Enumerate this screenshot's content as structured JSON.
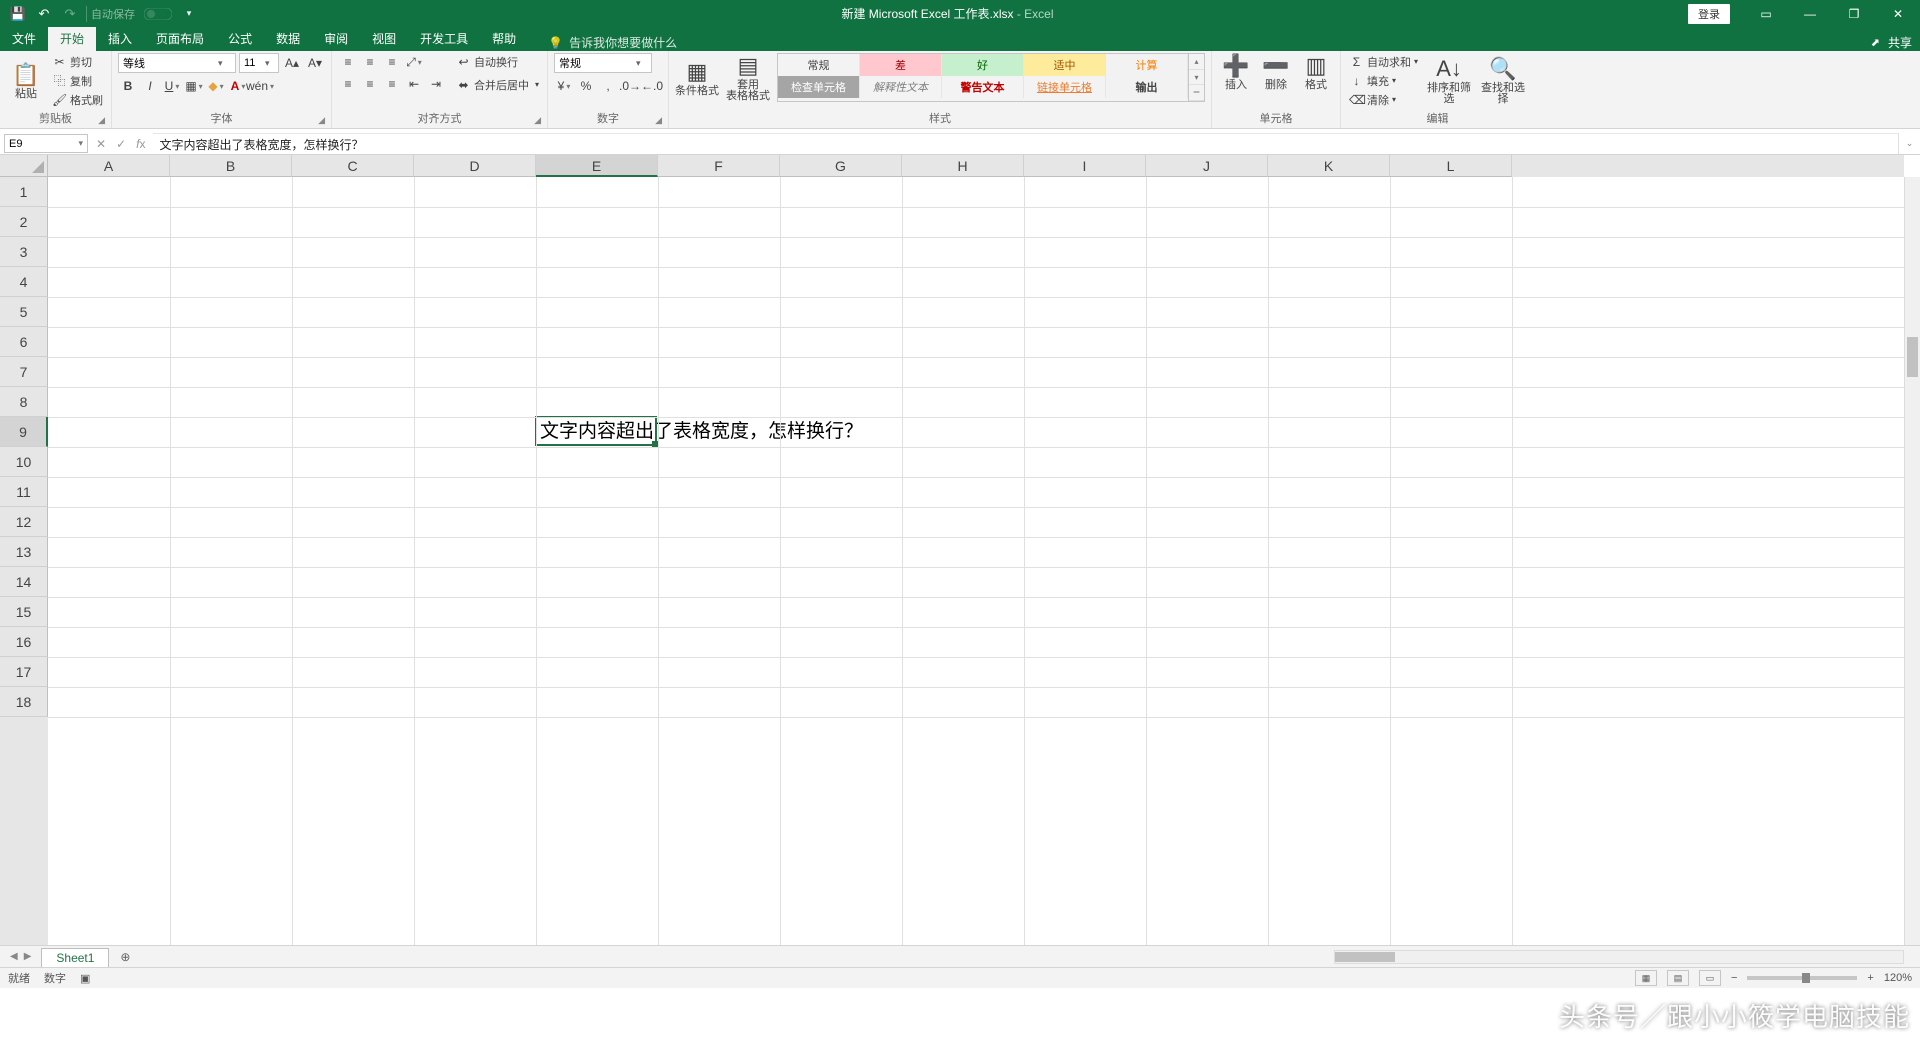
{
  "title": {
    "doc": "新建 Microsoft Excel 工作表.xlsx",
    "app": "Excel",
    "sep": " - "
  },
  "qat": {
    "autosave": "自动保存"
  },
  "login_btn": "登录",
  "share": "共享",
  "tabs": {
    "file": "文件",
    "home": "开始",
    "insert": "插入",
    "layout": "页面布局",
    "formulas": "公式",
    "data": "数据",
    "review": "审阅",
    "view": "视图",
    "dev": "开发工具",
    "help": "帮助"
  },
  "tell_me_placeholder": "告诉我你想要做什么",
  "ribbon": {
    "clipboard": {
      "paste": "粘贴",
      "cut": "剪切",
      "copy": "复制",
      "painter": "格式刷",
      "label": "剪贴板"
    },
    "font": {
      "name": "等线",
      "size": "11",
      "label": "字体"
    },
    "align": {
      "wrap": "自动换行",
      "merge": "合并后居中",
      "label": "对齐方式"
    },
    "number": {
      "format": "常规",
      "label": "数字"
    },
    "styles": {
      "cond": "条件格式",
      "table": "套用\n表格格式",
      "g": {
        "normal": "常规",
        "bad": "差",
        "good": "好",
        "neutral": "适中",
        "calc": "计算",
        "check": "检查单元格",
        "explain": "解释性文本",
        "warn": "警告文本",
        "link": "链接单元格",
        "output": "输出"
      },
      "label": "样式"
    },
    "cells": {
      "insert": "插入",
      "delete": "删除",
      "format": "格式",
      "label": "单元格"
    },
    "editing": {
      "sum": "自动求和",
      "fill": "填充",
      "clear": "清除",
      "sort": "排序和筛选",
      "find": "查找和选择",
      "label": "编辑"
    }
  },
  "name_box": "E9",
  "formula_text": "文字内容超出了表格宽度，怎样换行？",
  "columns": [
    "A",
    "B",
    "C",
    "D",
    "E",
    "F",
    "G",
    "H",
    "I",
    "J",
    "K",
    "L"
  ],
  "rows": [
    1,
    2,
    3,
    4,
    5,
    6,
    7,
    8,
    9,
    10,
    11,
    12,
    13,
    14,
    15,
    16,
    17,
    18
  ],
  "selected_col_index": 4,
  "selected_row_index": 8,
  "cell_text": "文字内容超出了表格宽度，怎样换行？",
  "sheet_tab": "Sheet1",
  "status": {
    "ready": "就绪",
    "num": "数字"
  },
  "zoom": "120%",
  "watermark": "头条号／跟小小筱学电脑技能"
}
